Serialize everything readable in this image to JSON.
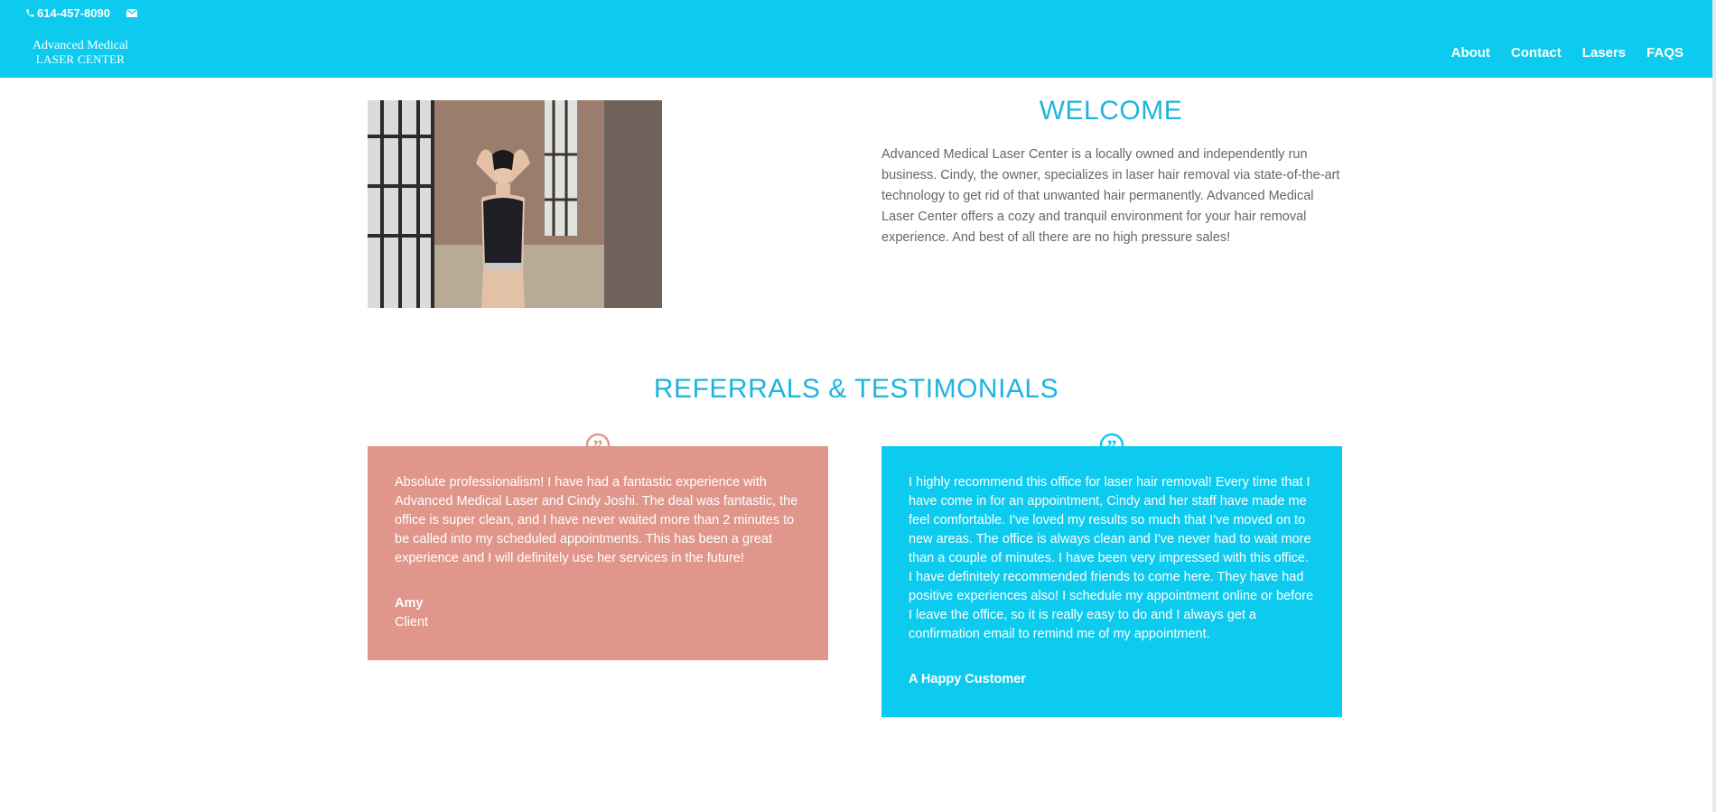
{
  "topbar": {
    "phone": "614-457-8090",
    "phone_icon": "phone-icon",
    "email_icon": "mail-icon"
  },
  "logo": {
    "line1": "Advanced Medical",
    "line2": "LASER CENTER"
  },
  "nav": {
    "items": [
      {
        "label": "About"
      },
      {
        "label": "Contact"
      },
      {
        "label": "Lasers"
      },
      {
        "label": "FAQS"
      }
    ]
  },
  "welcome": {
    "title": "WELCOME",
    "body": "Advanced Medical Laser Center is a locally owned and independently run business. Cindy, the owner, specializes in laser hair removal via state-of-the-art technology to get rid of that unwanted hair permanently. Advanced Medical Laser Center offers a cozy and tranquil environment for your hair removal experience. And best of all there are no high pressure sales!"
  },
  "testimonials": {
    "title": "REFERRALS & TESTIMONIALS",
    "items": [
      {
        "text": "Absolute professionalism! I have had a fantastic experience with Advanced Medical Laser and Cindy Joshi. The deal was fantastic, the office is super clean, and I have never waited more than 2 minutes to be called into my scheduled appointments. This has been a great experience and I will definitely use her services in the future!",
        "author": "Amy",
        "role": "Client",
        "color": "#e0968a"
      },
      {
        "text": "I highly recommend this office for laser hair removal! Every time that I have come in for an appointment, Cindy and her staff have made me feel comfortable. I've loved my results so much that I've moved on to new areas. The office is always clean and I've never had to wait more than a couple of minutes. I have been very impressed with this office. I have definitely recommended friends to come here. They have had positive experiences also! I schedule my appointment online or before I leave the office, so it is really easy to do and I always get a confirmation email to remind me of my appointment.",
        "author": "A Happy Customer",
        "color": "#0ccbef"
      }
    ]
  },
  "colors": {
    "header": "#0ccbef",
    "heading": "#1fb4de",
    "body_text": "#666666"
  }
}
